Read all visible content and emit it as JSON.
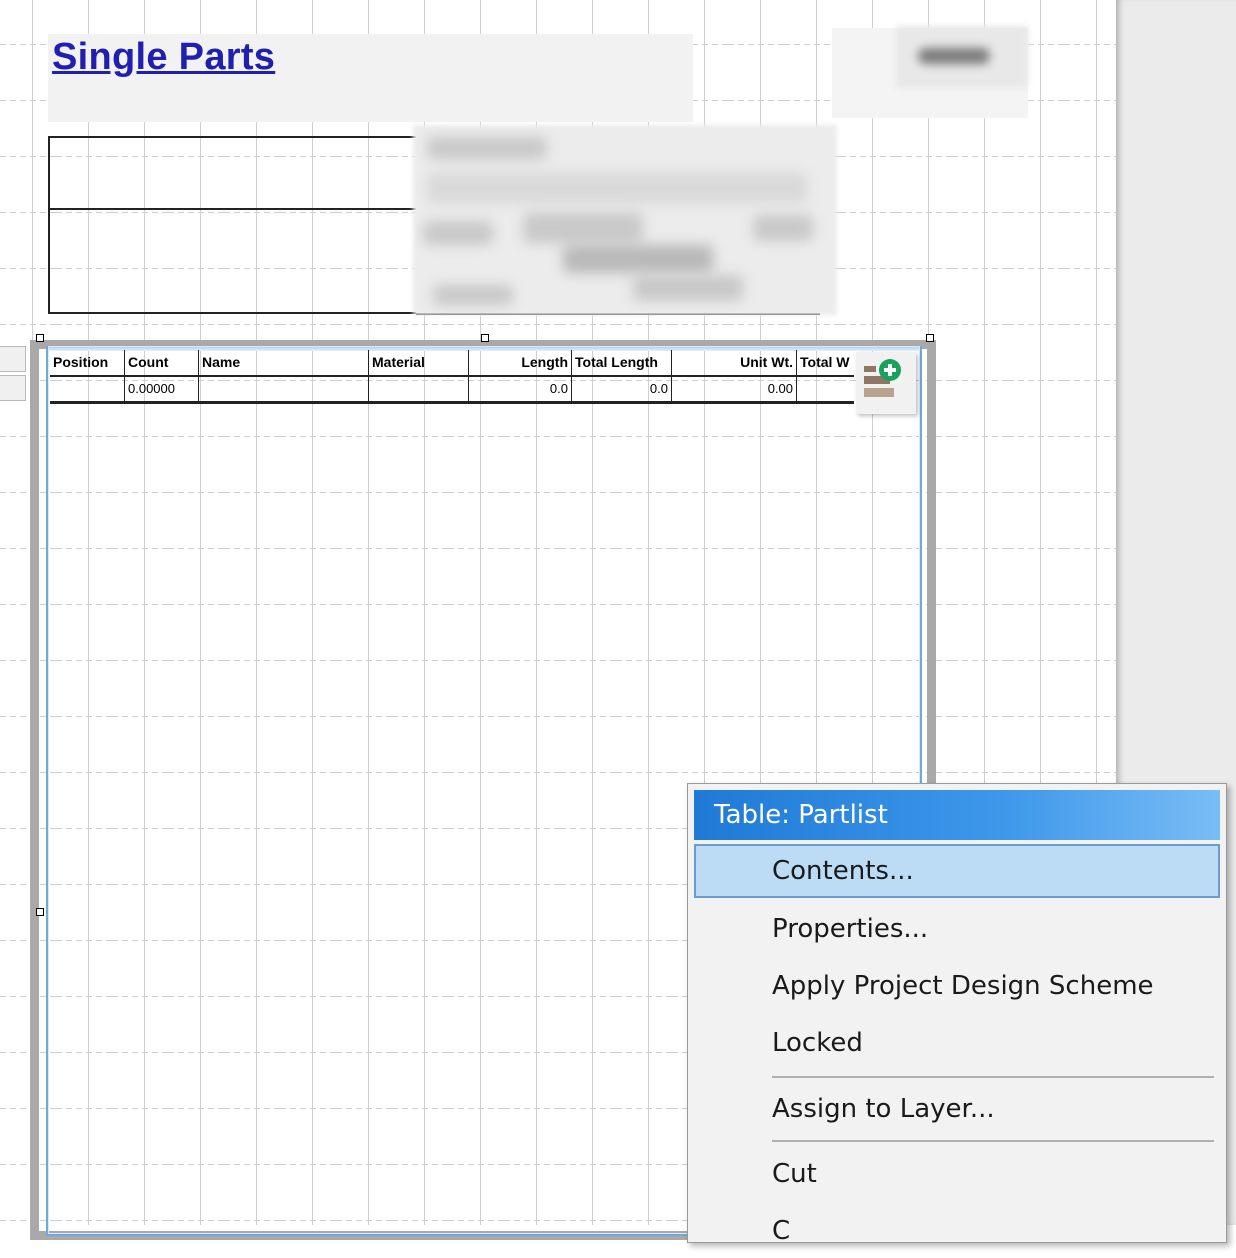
{
  "report": {
    "title": "Single Parts"
  },
  "table": {
    "columns": [
      "Position",
      "Count",
      "Name",
      "Material",
      "Length",
      "Total Length",
      "Unit Wt.",
      "Total W"
    ],
    "row": [
      "",
      "0.00000",
      "",
      "",
      "0.0",
      "0.0",
      "0.00",
      ""
    ]
  },
  "context_menu": {
    "header": "Table: Partlist",
    "items": [
      {
        "label": "Contents...",
        "highlighted": true
      },
      {
        "label": "Properties..."
      },
      {
        "label": "Apply Project Design Scheme"
      },
      {
        "label": "Locked"
      },
      {
        "label": "Assign to Layer..."
      },
      {
        "label": "Cut"
      },
      {
        "label": "C"
      }
    ]
  },
  "icons": {
    "add_column": "add-column-icon"
  },
  "colors": {
    "title": "#1f1fb0",
    "menu_header": "#1f7ad6",
    "menu_highlight": "#bcdcf6",
    "selection": "#6ea8dc"
  }
}
